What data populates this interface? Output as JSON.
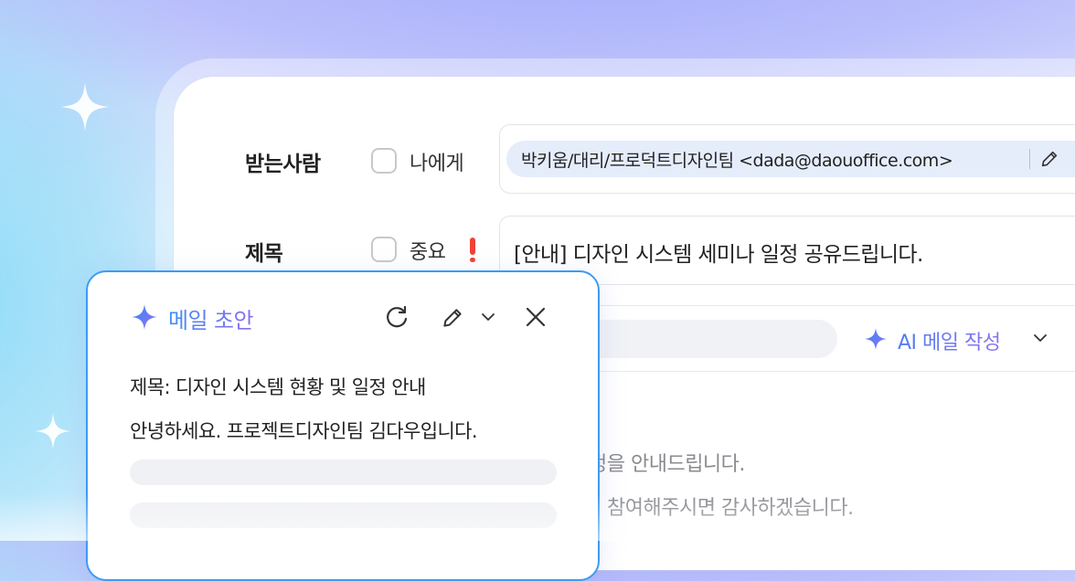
{
  "compose": {
    "to_label": "받는사람",
    "to_self_option": "나에게",
    "recipient_chip": "박키움/대리/프로덕트디자인팀 <dada@daouoffice.com>",
    "subject_label": "제목",
    "important_option": "중요",
    "subject_value": "[안내] 디자인 시스템 세미나 일정 공유드립니다.",
    "ai_write_button": "AI 메일 작성",
    "body_lines": [
      "정을 안내드립니다.",
      "참여해주시면 감사하겠습니다."
    ]
  },
  "ai_panel": {
    "title": "메일 초안",
    "draft_subject": "제목: 디자인 시스템 현황 및 일정 안내",
    "draft_greeting": "안녕하세요. 프로젝트디자인팀 김다우입니다."
  },
  "colors": {
    "accent_blue": "#3c9bf4",
    "accent_purple": "#8a74ef",
    "important_red": "#ee4438",
    "chip_background": "#e5edfb"
  },
  "icons": {
    "panel_title_icon": "sparkle-icon",
    "refresh": "refresh-icon",
    "edit": "pencil-icon",
    "menu": "chevron-down-icon",
    "close": "close-icon",
    "chip_edit": "pencil-icon",
    "ai_write_icon": "sparkle-icon"
  }
}
